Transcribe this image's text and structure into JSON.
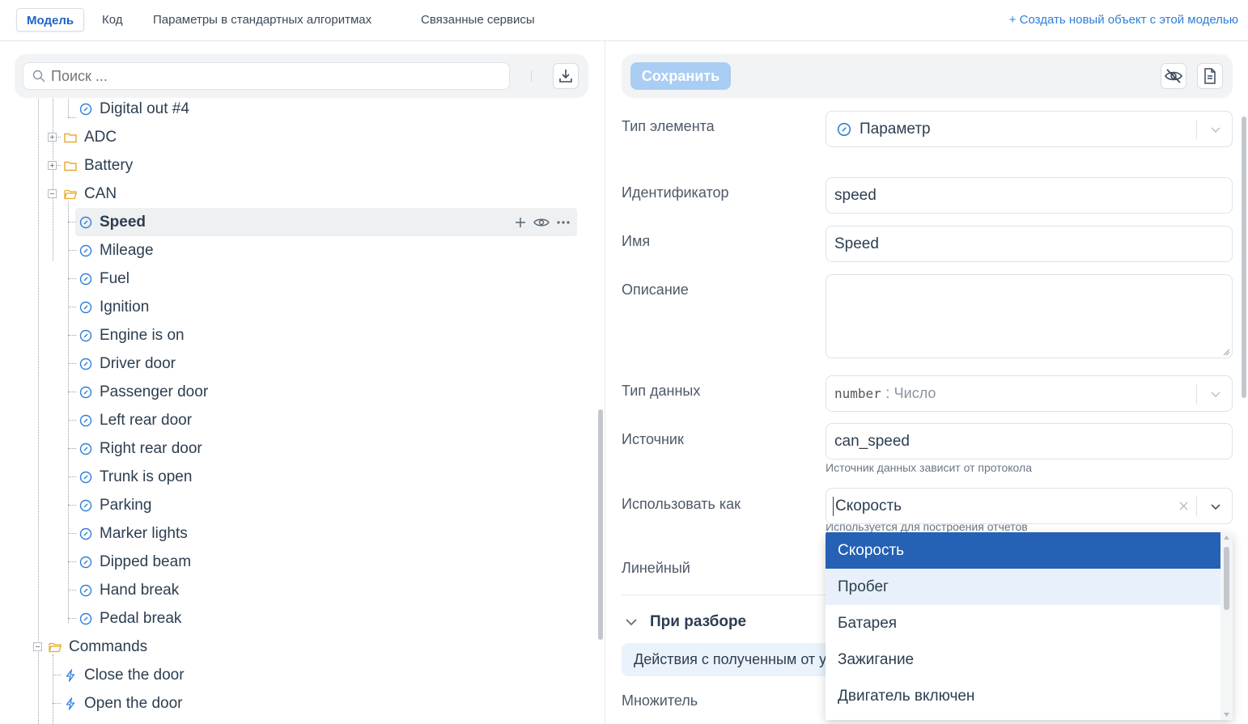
{
  "tabs": [
    {
      "label": "Модель",
      "active": true
    },
    {
      "label": "Код",
      "active": false
    },
    {
      "label": "Параметры в стандартных алгоритмах",
      "active": false
    },
    {
      "label": "Связанные сервисы",
      "active": false
    }
  ],
  "create_link": "+ Создать новый объект с этой моделью",
  "search": {
    "placeholder": "Поиск ..."
  },
  "tree": {
    "digital_out": "Digital out #4",
    "adc": "ADC",
    "battery": "Battery",
    "can": "CAN",
    "can_children": [
      "Speed",
      "Mileage",
      "Fuel",
      "Ignition",
      "Engine is on",
      "Driver door",
      "Passenger door",
      "Left rear door",
      "Right rear door",
      "Trunk is open",
      "Parking",
      "Marker lights",
      "Dipped beam",
      "Hand break",
      "Pedal break"
    ],
    "commands": "Commands",
    "command_children": [
      "Close the door",
      "Open the door"
    ],
    "selected": "Speed"
  },
  "toolbar": {
    "save_label": "Сохранить"
  },
  "form": {
    "element_type_label": "Тип элемента",
    "element_type_value": "Параметр",
    "identifier_label": "Идентификатор",
    "identifier_value": "speed",
    "name_label": "Имя",
    "name_value": "Speed",
    "description_label": "Описание",
    "description_value": "",
    "data_type_label": "Тип данных",
    "data_type_code": "number",
    "data_type_sep": " : ",
    "data_type_text": "Число",
    "source_label": "Источник",
    "source_value": "can_speed",
    "source_hint": "Источник данных зависит от протокола",
    "use_as_label": "Использовать как",
    "use_as_value": "Скорость",
    "use_as_hint": "Используется для построения отчетов",
    "linear_label": "Линейный",
    "section_title": "При разборе",
    "info_text": "Действия с полученным от устройства значением",
    "multiplier_label": "Множитель"
  },
  "dropdown": {
    "options": [
      "Скорость",
      "Пробег",
      "Батарея",
      "Зажигание",
      "Двигатель включен"
    ],
    "selected_index": 0,
    "hover_index": 1
  },
  "colors": {
    "accent": "#1e64c8",
    "dropdown_selected": "#2561b4",
    "folder": "#e8a92a",
    "param_icon": "#2f7fd6"
  }
}
